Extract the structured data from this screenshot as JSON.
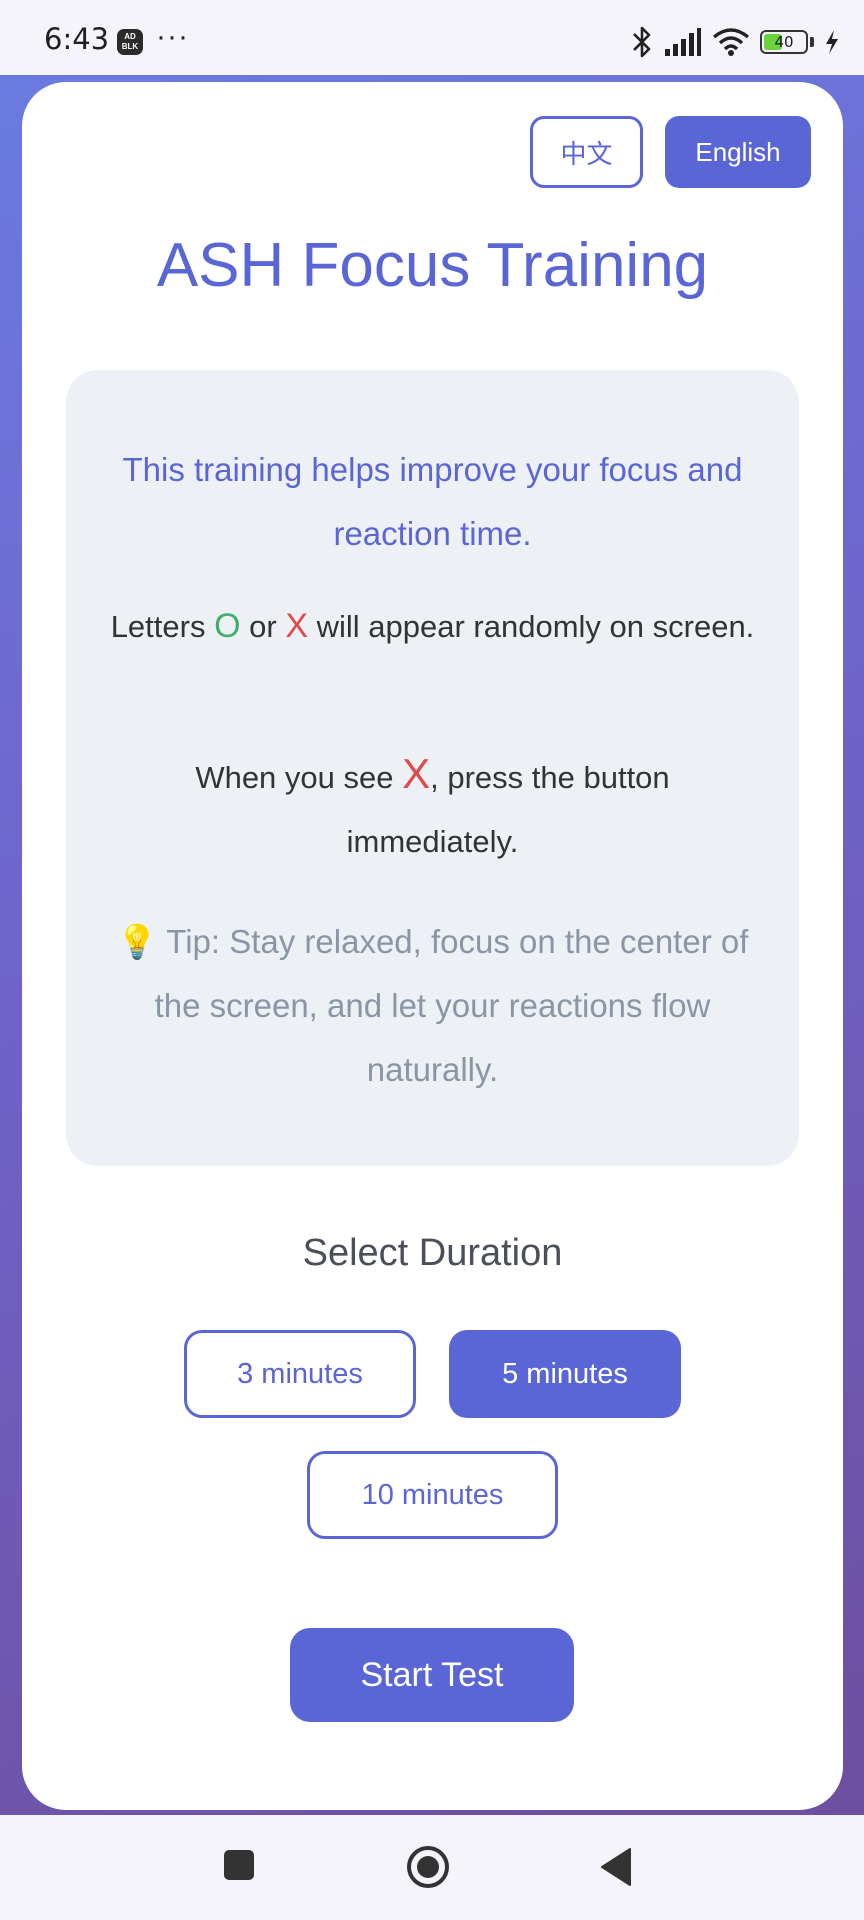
{
  "status_bar": {
    "time": "6:43",
    "adblock_label": "AD BLOCKER",
    "more": "···",
    "battery": "40",
    "battery_level": 0.4,
    "icons": [
      "bluetooth-icon",
      "signal-icon",
      "wifi-icon",
      "battery-icon",
      "charging-icon"
    ]
  },
  "language": {
    "chinese_label": "中文",
    "english_label": "English",
    "selected": "English"
  },
  "title": "ASH Focus Training",
  "info": {
    "intro": "This training helps improve your focus and reaction time.",
    "letters_prefix": "Letters ",
    "letter_o": "O",
    "letters_or": " or ",
    "letter_x": "X",
    "letters_suffix": " will appear randomly on screen.",
    "press_prefix": "When you see ",
    "press_x": "X",
    "press_suffix": ", press the button immediately.",
    "tip_icon": "💡",
    "tip": " Tip: Stay relaxed, focus on the center of the screen, and let your reactions flow naturally."
  },
  "duration": {
    "heading": "Select Duration",
    "options": [
      "3 minutes",
      "5 minutes",
      "10 minutes"
    ],
    "selected": "5 minutes"
  },
  "start_label": "Start Test",
  "colors": {
    "accent": "#5b66d6",
    "green_letter": "#3fb06a",
    "red_letter": "#e24a4a",
    "info_bg": "#edf1f5"
  },
  "nav": [
    "recents-button",
    "home-button",
    "back-button"
  ]
}
